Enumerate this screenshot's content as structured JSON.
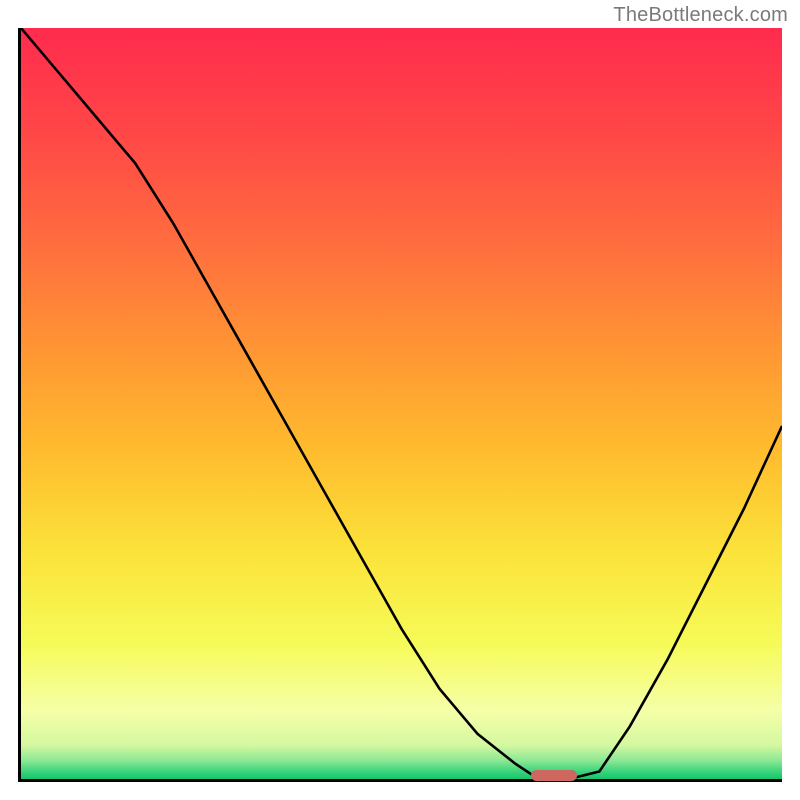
{
  "watermark": "TheBottleneck.com",
  "chart_data": {
    "type": "line",
    "title": "",
    "xlabel": "",
    "ylabel": "",
    "xlim": [
      0,
      100
    ],
    "ylim": [
      0,
      100
    ],
    "grid": false,
    "curve": {
      "x": [
        0,
        5,
        10,
        15,
        20,
        25,
        30,
        35,
        40,
        45,
        50,
        55,
        60,
        65,
        68,
        72,
        76,
        80,
        85,
        90,
        95,
        100
      ],
      "y": [
        100,
        94,
        88,
        82,
        74,
        65,
        56,
        47,
        38,
        29,
        20,
        12,
        6,
        2,
        0,
        0,
        1,
        7,
        16,
        26,
        36,
        47
      ]
    },
    "marker": {
      "x": 70,
      "y": 0.5,
      "w": 6,
      "h": 1.5,
      "color": "#cd6760"
    },
    "gradient_stops": [
      {
        "pos": 0.0,
        "color": "#ff2b4e"
      },
      {
        "pos": 0.14,
        "color": "#ff4747"
      },
      {
        "pos": 0.28,
        "color": "#ff6b3f"
      },
      {
        "pos": 0.42,
        "color": "#ff9334"
      },
      {
        "pos": 0.56,
        "color": "#ffbb2e"
      },
      {
        "pos": 0.7,
        "color": "#fbe33a"
      },
      {
        "pos": 0.82,
        "color": "#f6fb58"
      },
      {
        "pos": 0.91,
        "color": "#f5ffa8"
      },
      {
        "pos": 0.955,
        "color": "#d4f8a0"
      },
      {
        "pos": 0.975,
        "color": "#8ee895"
      },
      {
        "pos": 0.99,
        "color": "#3ad47c"
      },
      {
        "pos": 1.0,
        "color": "#17c46a"
      }
    ]
  }
}
